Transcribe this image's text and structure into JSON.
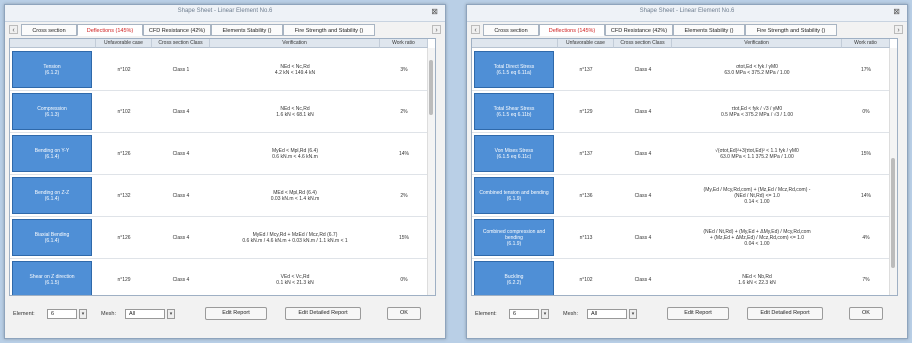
{
  "left": {
    "title": "Shape Sheet - Linear Element No.6",
    "tabs": [
      "Cross section",
      "Deflections (145%)",
      "CFD Resistance (42%)",
      "Elements Stability ()",
      "Fire Strength and Stability ()"
    ],
    "active_tab": 1,
    "headers": [
      "Unfavorable case",
      "Cross section Class",
      "Verification",
      "Work ratio"
    ],
    "rows": [
      {
        "name": "Tension\n(6.1.2)",
        "case": "n°102",
        "cls": "Class 1",
        "verif": "NEd < Nc,Rd\n4.2 kN < 149.4 kN",
        "ratio": "3%"
      },
      {
        "name": "Compression\n(6.1.3)",
        "case": "n°102",
        "cls": "Class 4",
        "verif": "NEd < Nc,Rd\n1.6 kN < 68.1 kN",
        "ratio": "2%"
      },
      {
        "name": "Bending on Y-Y\n(6.1.4)",
        "case": "n°126",
        "cls": "Class 4",
        "verif": "MyEd < Mpl,Rd (6.4)\n0.6 kN.m < 4.6 kN.m",
        "ratio": "14%"
      },
      {
        "name": "Bending on Z-Z\n(6.1.4)",
        "case": "n°132",
        "cls": "Class 4",
        "verif": "MEd < Mpl,Rd (6.4)\n0.03 kN.m < 1.4 kN.m",
        "ratio": "2%"
      },
      {
        "name": "Biaxial Bending\n(6.1.4)",
        "case": "n°126",
        "cls": "Class 4",
        "verif": "MyEd / Mcy,Rd + MzEd / Mcz,Rd (6.7)\n0.6 kN.m / 4.6 kN.m + 0.03 kN.m / 1.1 kN.m < 1",
        "ratio": "15%"
      },
      {
        "name": "Shear on Z direction\n(6.1.5)",
        "case": "n°129",
        "cls": "Class 4",
        "verif": "VEd < Vc,Rd\n0.1 kN < 21.3 kN",
        "ratio": "0%"
      }
    ],
    "footer": {
      "element_label": "Element:",
      "element_value": "6",
      "mesh_label": "Mesh:",
      "mesh_value": "All",
      "edit_report": "Edit Report",
      "edit_detailed_report": "Edit Detailed Report",
      "ok": "OK"
    }
  },
  "right": {
    "title": "Shape Sheet - Linear Element No.6",
    "tabs": [
      "Cross section",
      "Deflections (145%)",
      "CFD Resistance (42%)",
      "Elements Stability ()",
      "Fire Strength and Stability ()"
    ],
    "active_tab": 1,
    "headers": [
      "Unfavorable case",
      "Cross section Class",
      "Verification",
      "Work ratio"
    ],
    "rows": [
      {
        "name": "Total Direct Stress\n(6.1.5 eq 6.11a)",
        "case": "n°137",
        "cls": "Class 4",
        "verif": "σtot,Ed < fyk / γM0\n63.0 MPa < 375.2 MPa / 1.00",
        "ratio": "17%"
      },
      {
        "name": "Total Shear Stress\n(6.1.5 eq 6.11b)",
        "case": "n°129",
        "cls": "Class 4",
        "verif": "τtot,Ed < fyk / √3 / γM0\n0.5 MPa < 375.2 MPa / √3 / 1.00",
        "ratio": "0%"
      },
      {
        "name": "Von Mises Stress\n(6.1.5 eq 6.11c)",
        "case": "n°137",
        "cls": "Class 4",
        "verif": "√(σtot,Ed)²+3(τtot,Ed)² < 1.1 fyk / γM0\n63.0 MPa < 1.1 375.2 MPa / 1.00",
        "ratio": "15%"
      },
      {
        "name": "Combined tension and bending\n(6.1.9)",
        "case": "n°136",
        "cls": "Class 4",
        "verif": "(My,Ed / Mcy,Rd,com) + (Mz,Ed / Mcz,Rd,com) -\n(NEd / Nt,Rd) <= 1.0\n0.14 < 1.00",
        "ratio": "14%"
      },
      {
        "name": "Combined compression and bending\n(6.1.9)",
        "case": "n°113",
        "cls": "Class 4",
        "verif": "(NEd / Nt,Rd) + (My,Ed + ΔMy,Ed) / Mcy,Rd,com\n+ (Mz,Ed + ΔMz,Ed) / Mcz,Rd,com) <= 1.0\n0.04 < 1.00",
        "ratio": "4%"
      },
      {
        "name": "Buckling\n(6.2.2)",
        "case": "n°102",
        "cls": "Class 4",
        "verif": "NEd < Nb,Rd\n1.6 kN < 22.3 kN",
        "ratio": "7%"
      }
    ],
    "footer": {
      "element_label": "Element:",
      "element_value": "6",
      "mesh_label": "Mesh:",
      "mesh_value": "All",
      "edit_report": "Edit Report",
      "edit_detailed_report": "Edit Detailed Report",
      "ok": "OK"
    }
  }
}
